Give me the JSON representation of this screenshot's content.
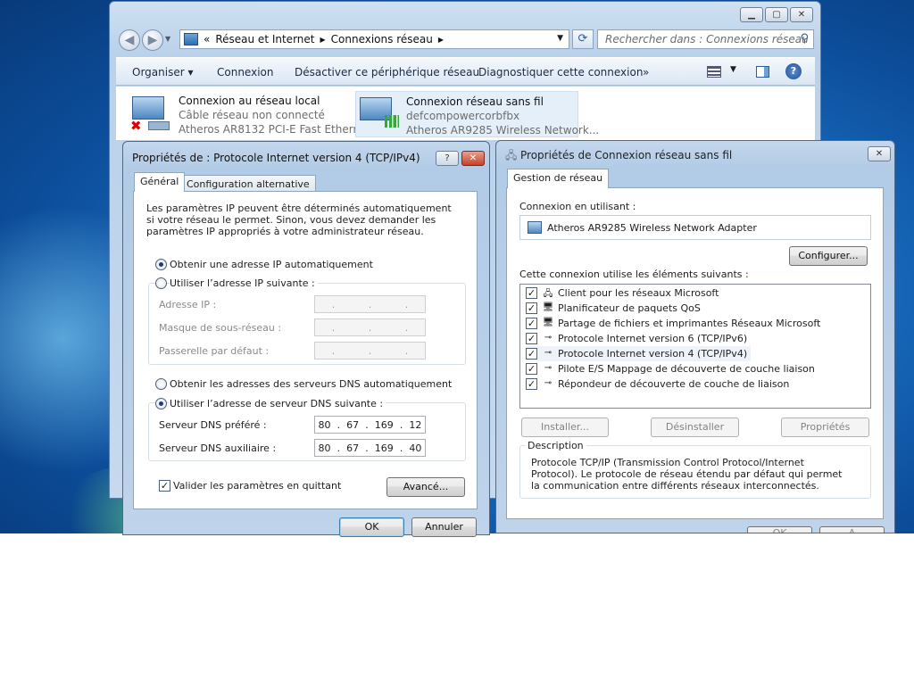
{
  "explorer": {
    "breadcrumb_lead": "«",
    "breadcrumb": [
      "Réseau et Internet",
      "Connexions réseau"
    ],
    "search_placeholder": "Rechercher dans : Connexions réseau",
    "toolbar": {
      "organize": "Organiser",
      "connect": "Connexion",
      "disable": "Désactiver ce périphérique réseau",
      "diagnose": "Diagnostiquer cette connexion",
      "more": "»"
    },
    "connections": [
      {
        "name": "Connexion au réseau local",
        "status": "Câble réseau non connecté",
        "adapter": "Atheros AR8132 PCI-E Fast Ethern..."
      },
      {
        "name": "Connexion réseau sans fil",
        "status": "defcompowercorbfbx",
        "adapter": "Atheros AR9285 Wireless Network..."
      }
    ]
  },
  "ipv4_dialog": {
    "title": "Propriétés de : Protocole Internet version 4 (TCP/IPv4)",
    "tabs": [
      "Général",
      "Configuration alternative"
    ],
    "intro": "Les paramètres IP peuvent être déterminés automatiquement si votre réseau le permet. Sinon, vous devez demander les paramètres IP appropriés à votre administrateur réseau.",
    "radio_auto_ip": "Obtenir une adresse IP automatiquement",
    "radio_manual_ip": "Utiliser l’adresse IP suivante :",
    "ip_label": "Adresse IP :",
    "mask_label": "Masque de sous-réseau :",
    "gateway_label": "Passerelle par défaut :",
    "radio_auto_dns": "Obtenir les adresses des serveurs DNS automatiquement",
    "radio_manual_dns": "Utiliser l’adresse de serveur DNS suivante :",
    "dns_pref_label": "Serveur DNS préféré :",
    "dns_pref": [
      "80",
      "67",
      "169",
      "12"
    ],
    "dns_alt_label": "Serveur DNS auxiliaire :",
    "dns_alt": [
      "80",
      "67",
      "169",
      "40"
    ],
    "validate_label": "Valider les paramètres en quittant",
    "advanced_button": "Avancé...",
    "ok_button": "OK",
    "cancel_button": "Annuler"
  },
  "wifi_dialog": {
    "title": "Propriétés de Connexion réseau sans fil",
    "tab": "Gestion de réseau",
    "connect_using_label": "Connexion en utilisant :",
    "adapter": "Atheros AR9285 Wireless Network Adapter",
    "configure_button": "Configurer...",
    "items_label": "Cette connexion utilise les éléments suivants :",
    "items": [
      "Client pour les réseaux Microsoft",
      "Planificateur de paquets QoS",
      "Partage de fichiers et imprimantes Réseaux Microsoft",
      "Protocole Internet version 6 (TCP/IPv6)",
      "Protocole Internet version 4 (TCP/IPv4)",
      "Pilote E/S Mappage de découverte de couche liaison",
      "Répondeur de découverte de couche de liaison"
    ],
    "install_button": "Installer...",
    "uninstall_button": "Désinstaller",
    "properties_button": "Propriétés",
    "description_label": "Description",
    "description": "Protocole TCP/IP (Transmission Control Protocol/Internet Protocol). Le protocole de réseau étendu par défaut qui permet la communication entre différents réseaux interconnectés.",
    "ok_partial": "OK",
    "cancel_partial": "A"
  },
  "colors": {
    "desktop": "#1a6fc2",
    "window_frame": "#b9d1ea",
    "selection": "#e5eff9"
  }
}
